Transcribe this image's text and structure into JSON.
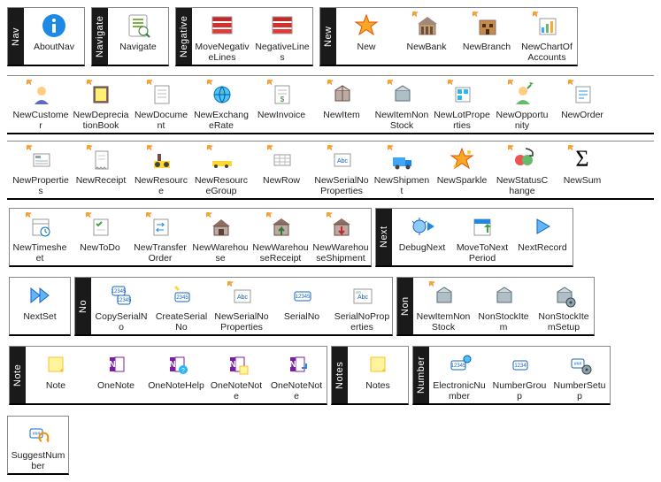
{
  "groups": [
    {
      "name": "Nav",
      "items": [
        {
          "label": "AboutNav",
          "icon": "info"
        }
      ]
    },
    {
      "name": "Navigate",
      "items": [
        {
          "label": "Navigate",
          "icon": "navigate"
        }
      ]
    },
    {
      "name": "Negative",
      "items": [
        {
          "label": "MoveNegativeLines",
          "icon": "neglines"
        },
        {
          "label": "NegativeLines",
          "icon": "neglines"
        }
      ]
    },
    {
      "name": "New",
      "items": [
        {
          "label": "New",
          "icon": "star"
        },
        {
          "label": "NewBank",
          "icon": "bank"
        },
        {
          "label": "NewBranch",
          "icon": "branch"
        },
        {
          "label": "NewChartOfAccounts",
          "icon": "chartacc"
        }
      ]
    }
  ],
  "free_new": [
    {
      "label": "NewCustomer",
      "icon": "customer"
    },
    {
      "label": "NewDepreciationBook",
      "icon": "book"
    },
    {
      "label": "NewDocument",
      "icon": "doc"
    },
    {
      "label": "NewExchangeRate",
      "icon": "globe"
    },
    {
      "label": "NewInvoice",
      "icon": "invoice"
    },
    {
      "label": "NewItem",
      "icon": "item"
    },
    {
      "label": "NewItemNonStock",
      "icon": "itemnon"
    },
    {
      "label": "NewLotProperties",
      "icon": "lot"
    },
    {
      "label": "NewOpportunity",
      "icon": "opp"
    },
    {
      "label": "NewOrder",
      "icon": "order"
    },
    {
      "label": "NewProperties",
      "icon": "props"
    },
    {
      "label": "NewReceipt",
      "icon": "receipt"
    },
    {
      "label": "NewResource",
      "icon": "resource"
    },
    {
      "label": "NewResourceGroup",
      "icon": "resgroup"
    },
    {
      "label": "NewRow",
      "icon": "row"
    },
    {
      "label": "NewSerialNoProperties",
      "icon": "serialprop"
    },
    {
      "label": "NewShipment",
      "icon": "shipment"
    },
    {
      "label": "NewSparkle",
      "icon": "sparkle"
    },
    {
      "label": "NewStatusChange",
      "icon": "status"
    },
    {
      "label": "NewSum",
      "icon": "sum"
    },
    {
      "label": "NewTimesheet",
      "icon": "timesheet"
    },
    {
      "label": "NewToDo",
      "icon": "todo"
    },
    {
      "label": "NewTransferOrder",
      "icon": "transfer"
    },
    {
      "label": "NewWarehouse",
      "icon": "warehouse"
    },
    {
      "label": "NewWarehouseReceipt",
      "icon": "whreceipt"
    },
    {
      "label": "NewWarehouseShipment",
      "icon": "whshipment"
    }
  ],
  "groups2": [
    {
      "name": "Next",
      "items": [
        {
          "label": "DebugNext",
          "icon": "debugnext"
        },
        {
          "label": "MoveToNextPeriod",
          "icon": "nextperiod"
        },
        {
          "label": "NextRecord",
          "icon": "nextrec"
        }
      ]
    }
  ],
  "free_next": [
    {
      "label": "NextSet",
      "icon": "nextset"
    }
  ],
  "groups3": [
    {
      "name": "No",
      "items": [
        {
          "label": "CopySerialNo",
          "icon": "copyserial"
        },
        {
          "label": "CreateSerialNo",
          "icon": "createserial"
        },
        {
          "label": "NewSerialNoProperties",
          "icon": "serialprop2"
        },
        {
          "label": "SerialNo",
          "icon": "serial"
        },
        {
          "label": "SerialNoProperties",
          "icon": "serialprops"
        }
      ]
    },
    {
      "name": "Non",
      "items": [
        {
          "label": "NewItemNonStock",
          "icon": "itemnon2"
        },
        {
          "label": "NonStockItem",
          "icon": "nonstock"
        },
        {
          "label": "NonStockItemSetup",
          "icon": "nonstocksetup"
        }
      ]
    },
    {
      "name": "Note",
      "items": [
        {
          "label": "Note",
          "icon": "note"
        },
        {
          "label": "OneNote",
          "icon": "onenote"
        },
        {
          "label": "OneNoteHelp",
          "icon": "onenotehelp"
        },
        {
          "label": "OneNoteNote",
          "icon": "onenotenote"
        },
        {
          "label": "OneNoteNote",
          "icon": "onenotenote2"
        }
      ]
    },
    {
      "name": "Notes",
      "items": [
        {
          "label": "Notes",
          "icon": "notes"
        }
      ]
    },
    {
      "name": "Number",
      "items": [
        {
          "label": "ElectronicNumber",
          "icon": "enumber"
        },
        {
          "label": "NumberGroup",
          "icon": "numgroup"
        },
        {
          "label": "NumberSetup",
          "icon": "numsetup"
        }
      ]
    }
  ],
  "trailing": [
    {
      "label": "SuggestNumber",
      "icon": "suggest"
    }
  ]
}
